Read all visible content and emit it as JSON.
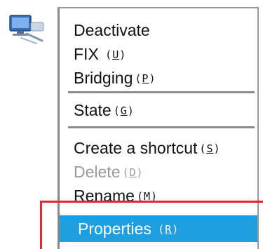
{
  "menu": {
    "items": [
      {
        "label": "Deactivate",
        "accel_open": "",
        "accel_key": "",
        "accel_close": ""
      },
      {
        "label": "FIX ",
        "accel_open": "(",
        "accel_key": "U",
        "accel_close": ")"
      },
      {
        "label": "Bridging",
        "accel_open": "(",
        "accel_key": "P",
        "accel_close": ")"
      },
      {
        "label": "State",
        "accel_open": "(",
        "accel_key": "G",
        "accel_close": ")"
      },
      {
        "label": "Create a shortcut",
        "accel_open": "(",
        "accel_key": "S",
        "accel_close": ")"
      },
      {
        "label": "Delete",
        "accel_open": "(",
        "accel_key": "D",
        "accel_close": ")",
        "disabled": true
      },
      {
        "label": "Rename",
        "accel_open": "(",
        "accel_key": "M",
        "accel_close": ")"
      },
      {
        "label": "Properties ",
        "accel_open": "(",
        "accel_key": "R",
        "accel_close": ")",
        "highlighted": true
      }
    ]
  },
  "colors": {
    "highlight": "#1f9fdf",
    "callout_frame": "#e0282f",
    "disabled_text": "#9a9a9a"
  },
  "icon": "network-connection-icon"
}
